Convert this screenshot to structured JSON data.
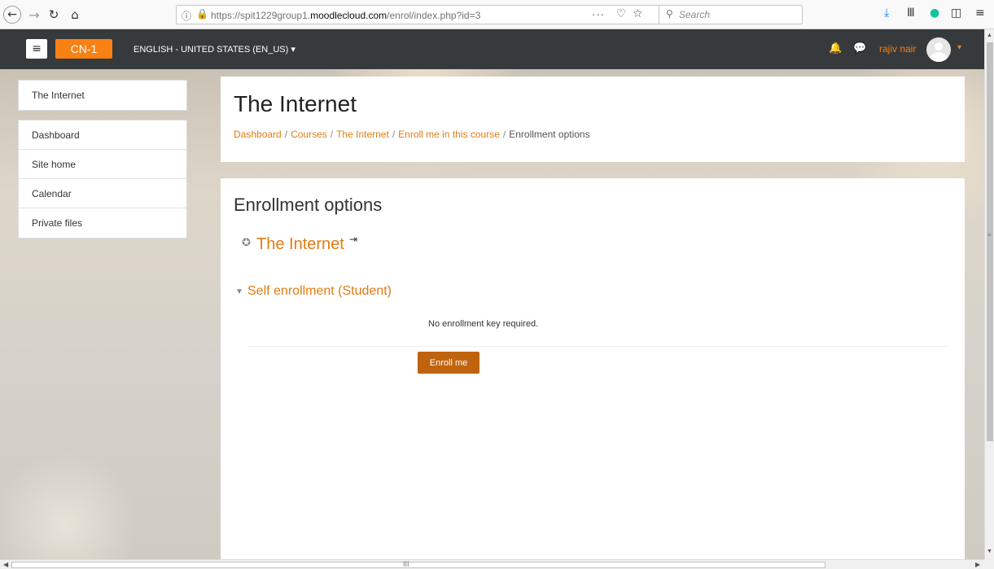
{
  "browser": {
    "url_prefix": "https://spit1229group1.",
    "url_domain": "moodlecloud.com",
    "url_path": "/enrol/index.php?id=3",
    "search_placeholder": "Search",
    "icons": {
      "back": "←",
      "forward": "→",
      "reload": "↻",
      "home": "⌂",
      "info": "ⓘ",
      "lock": "🔒",
      "more": "···",
      "pocket": "♡",
      "star": "☆",
      "search": "⚲",
      "download": "⤓",
      "library": "Ⅲ",
      "grammarly": "●",
      "sidebar": "◫",
      "menu": "≡"
    }
  },
  "navbar": {
    "menu_icon": "≡",
    "brand": "CN-1",
    "language": "ENGLISH - UNITED STATES (EN_US) ▾",
    "bell_icon": "🔔",
    "chat_icon": "💬",
    "username": "rajiv nair",
    "user_caret": "▾",
    "colors": {
      "bar": "#373a3c",
      "brand": "#f98012"
    }
  },
  "sidebar": {
    "course_item": "The Internet",
    "items": [
      {
        "label": "Dashboard"
      },
      {
        "label": "Site home"
      },
      {
        "label": "Calendar"
      },
      {
        "label": "Private files"
      }
    ]
  },
  "header": {
    "title": "The Internet",
    "breadcrumb": [
      {
        "label": "Dashboard"
      },
      {
        "label": "Courses"
      },
      {
        "label": "The Internet"
      },
      {
        "label": "Enroll me in this course"
      }
    ],
    "breadcrumb_current": "Enrollment options",
    "separator": "/"
  },
  "main": {
    "title": "Enrollment options",
    "course_icon": "✪",
    "course_name": "The Internet",
    "enrol_icon": "⇥",
    "section_caret": "▼",
    "section_title": "Self enrollment (Student)",
    "key_text": "No enrollment key required.",
    "button_label": "Enroll me",
    "colors": {
      "link": "#e17c11",
      "button": "#c0630e"
    }
  },
  "scrollbars": {
    "up": "▲",
    "down": "▼",
    "left": "◀",
    "right": "▶",
    "grip_v": "≡",
    "grip_h": "III"
  }
}
